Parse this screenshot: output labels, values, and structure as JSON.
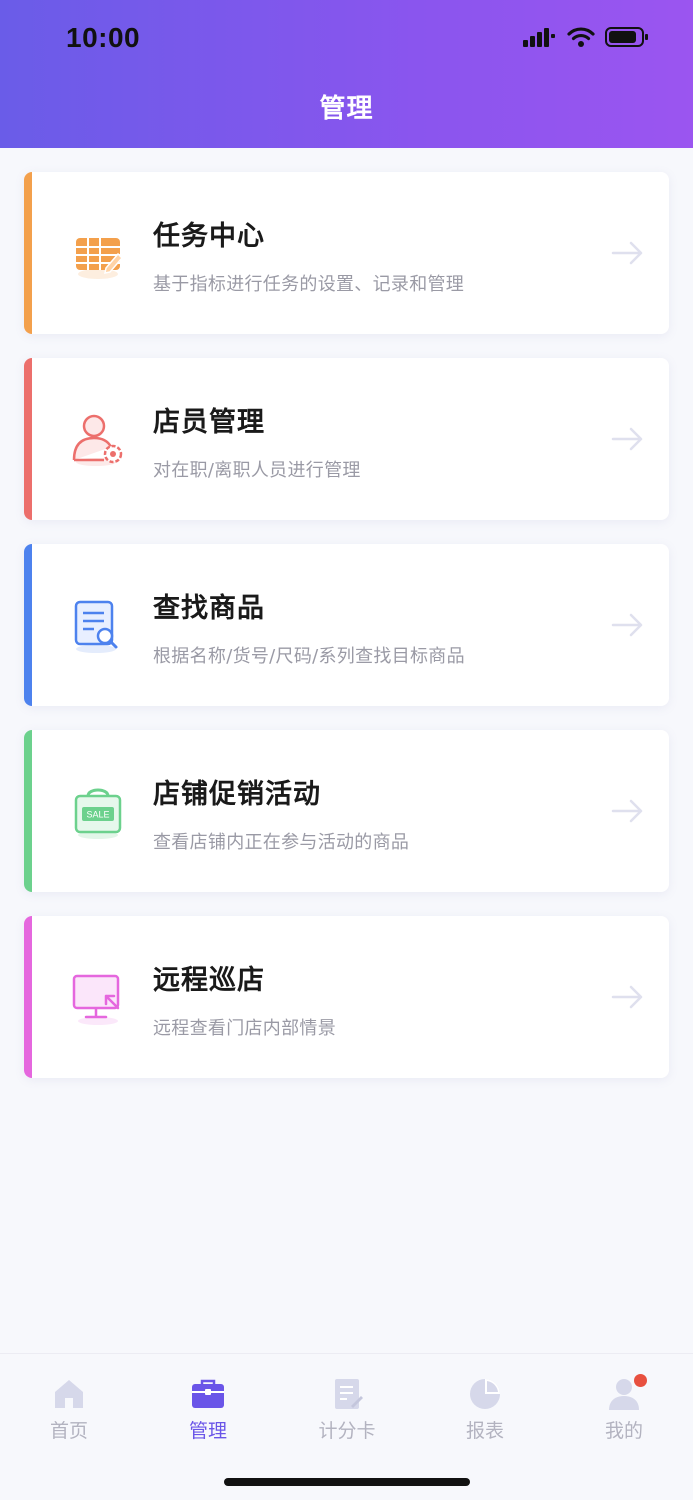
{
  "status_bar": {
    "time": "10:00"
  },
  "header": {
    "title": "管理"
  },
  "colors": {
    "accent": "#6a55e8",
    "orange": "#f3a04c",
    "red": "#ec6f6c",
    "blue": "#4d82ee",
    "green": "#6cd18d",
    "pink": "#e567de"
  },
  "cards": [
    {
      "title": "任务中心",
      "desc": "基于指标进行任务的设置、记录和管理",
      "icon": "task-table-edit-icon"
    },
    {
      "title": "店员管理",
      "desc": "对在职/离职人员进行管理",
      "icon": "staff-settings-icon"
    },
    {
      "title": "查找商品",
      "desc": "根据名称/货号/尺码/系列查找目标商品",
      "icon": "document-search-icon"
    },
    {
      "title": "店铺促销活动",
      "desc": "查看店铺内正在参与活动的商品",
      "icon": "sale-bag-icon"
    },
    {
      "title": "远程巡店",
      "desc": "远程查看门店内部情景",
      "icon": "monitor-remote-icon"
    }
  ],
  "tabbar": {
    "items": [
      {
        "label": "首页",
        "icon": "home-icon",
        "active": false
      },
      {
        "label": "管理",
        "icon": "briefcase-icon",
        "active": true
      },
      {
        "label": "计分卡",
        "icon": "scorecard-icon",
        "active": false
      },
      {
        "label": "报表",
        "icon": "pie-chart-icon",
        "active": false
      },
      {
        "label": "我的",
        "icon": "user-icon",
        "active": false,
        "badge": true
      }
    ]
  }
}
